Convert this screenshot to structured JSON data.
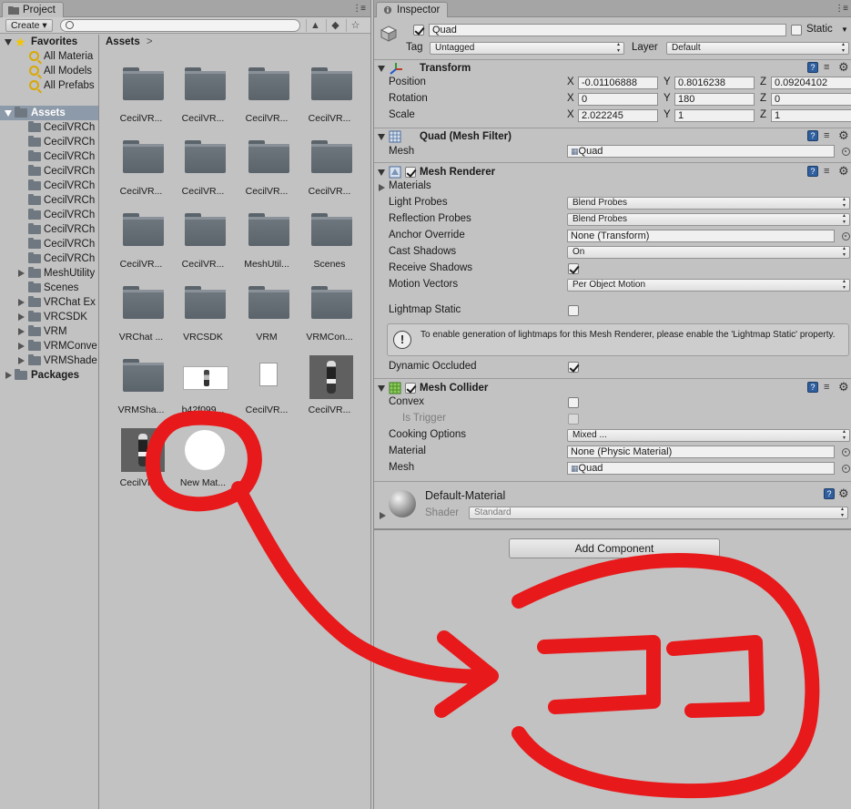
{
  "project": {
    "tab_label": "Project",
    "create_label": "Create ▾",
    "search_placeholder": "",
    "favorites_label": "Favorites",
    "favorites": [
      "All Materia",
      "All Models",
      "All Prefabs"
    ],
    "assets_label": "Assets",
    "tree_items": [
      "CecilVRCh",
      "CecilVRCh",
      "CecilVRCh",
      "CecilVRCh",
      "CecilVRCh",
      "CecilVRCh",
      "CecilVRCh",
      "CecilVRCh",
      "CecilVRCh",
      "CecilVRCh",
      "MeshUtility",
      "Scenes",
      "VRChat Ex",
      "VRCSDK",
      "VRM",
      "VRMConve",
      "VRMShade"
    ],
    "packages_label": "Packages",
    "breadcrumb": "Assets",
    "breadcrumb_arrow": ">",
    "grid": [
      {
        "label": "CecilVR...",
        "kind": "folder"
      },
      {
        "label": "CecilVR...",
        "kind": "folder"
      },
      {
        "label": "CecilVR...",
        "kind": "folder"
      },
      {
        "label": "CecilVR...",
        "kind": "folder"
      },
      {
        "label": "CecilVR...",
        "kind": "folder"
      },
      {
        "label": "CecilVR...",
        "kind": "folder"
      },
      {
        "label": "CecilVR...",
        "kind": "folder"
      },
      {
        "label": "CecilVR...",
        "kind": "folder"
      },
      {
        "label": "CecilVR...",
        "kind": "folder"
      },
      {
        "label": "CecilVR...",
        "kind": "folder"
      },
      {
        "label": "MeshUtil...",
        "kind": "folder"
      },
      {
        "label": "Scenes",
        "kind": "folder"
      },
      {
        "label": "VRChat ...",
        "kind": "folder"
      },
      {
        "label": "VRCSDK",
        "kind": "folder"
      },
      {
        "label": "VRM",
        "kind": "folder"
      },
      {
        "label": "VRMCon...",
        "kind": "folder"
      },
      {
        "label": "VRMSha...",
        "kind": "folder"
      },
      {
        "label": "b42f099...",
        "kind": "image"
      },
      {
        "label": "CecilVR...",
        "kind": "doc"
      },
      {
        "label": "CecilVR...",
        "kind": "character"
      },
      {
        "label": "CecilVR...",
        "kind": "character"
      },
      {
        "label": "New Mat...",
        "kind": "material"
      }
    ]
  },
  "inspector": {
    "tab_label": "Inspector",
    "object_name": "Quad",
    "static_label": "Static",
    "tag_label": "Tag",
    "tag_value": "Untagged",
    "layer_label": "Layer",
    "layer_value": "Default",
    "transform": {
      "title": "Transform",
      "position_label": "Position",
      "rotation_label": "Rotation",
      "scale_label": "Scale",
      "axis": [
        "X",
        "Y",
        "Z"
      ],
      "position": [
        "-0.01106888",
        "0.8016238",
        "0.09204102"
      ],
      "rotation": [
        "0",
        "180",
        "0"
      ],
      "scale": [
        "2.022245",
        "1",
        "1"
      ]
    },
    "mesh_filter": {
      "title": "Quad (Mesh Filter)",
      "mesh_label": "Mesh",
      "mesh_value": "Quad"
    },
    "mesh_renderer": {
      "title": "Mesh Renderer",
      "materials_label": "Materials",
      "light_probes_label": "Light Probes",
      "light_probes_value": "Blend Probes",
      "reflection_probes_label": "Reflection Probes",
      "reflection_probes_value": "Blend Probes",
      "anchor_override_label": "Anchor Override",
      "anchor_override_value": "None (Transform)",
      "cast_shadows_label": "Cast Shadows",
      "cast_shadows_value": "On",
      "receive_shadows_label": "Receive Shadows",
      "motion_vectors_label": "Motion Vectors",
      "motion_vectors_value": "Per Object Motion",
      "lightmap_static_label": "Lightmap Static",
      "help_text": "To enable generation of lightmaps for this Mesh Renderer, please enable the 'Lightmap Static' property.",
      "dynamic_occluded_label": "Dynamic Occluded"
    },
    "mesh_collider": {
      "title": "Mesh Collider",
      "convex_label": "Convex",
      "is_trigger_label": "Is Trigger",
      "cooking_options_label": "Cooking Options",
      "cooking_options_value": "Mixed ...",
      "material_label": "Material",
      "material_value": "None (Physic Material)",
      "mesh_label": "Mesh",
      "mesh_value": "Quad"
    },
    "material": {
      "name": "Default-Material",
      "shader_label": "Shader",
      "shader_value": "Standard"
    },
    "add_component_label": "Add Component"
  },
  "annotation": {
    "text": "ココ",
    "color": "#e8191b"
  }
}
